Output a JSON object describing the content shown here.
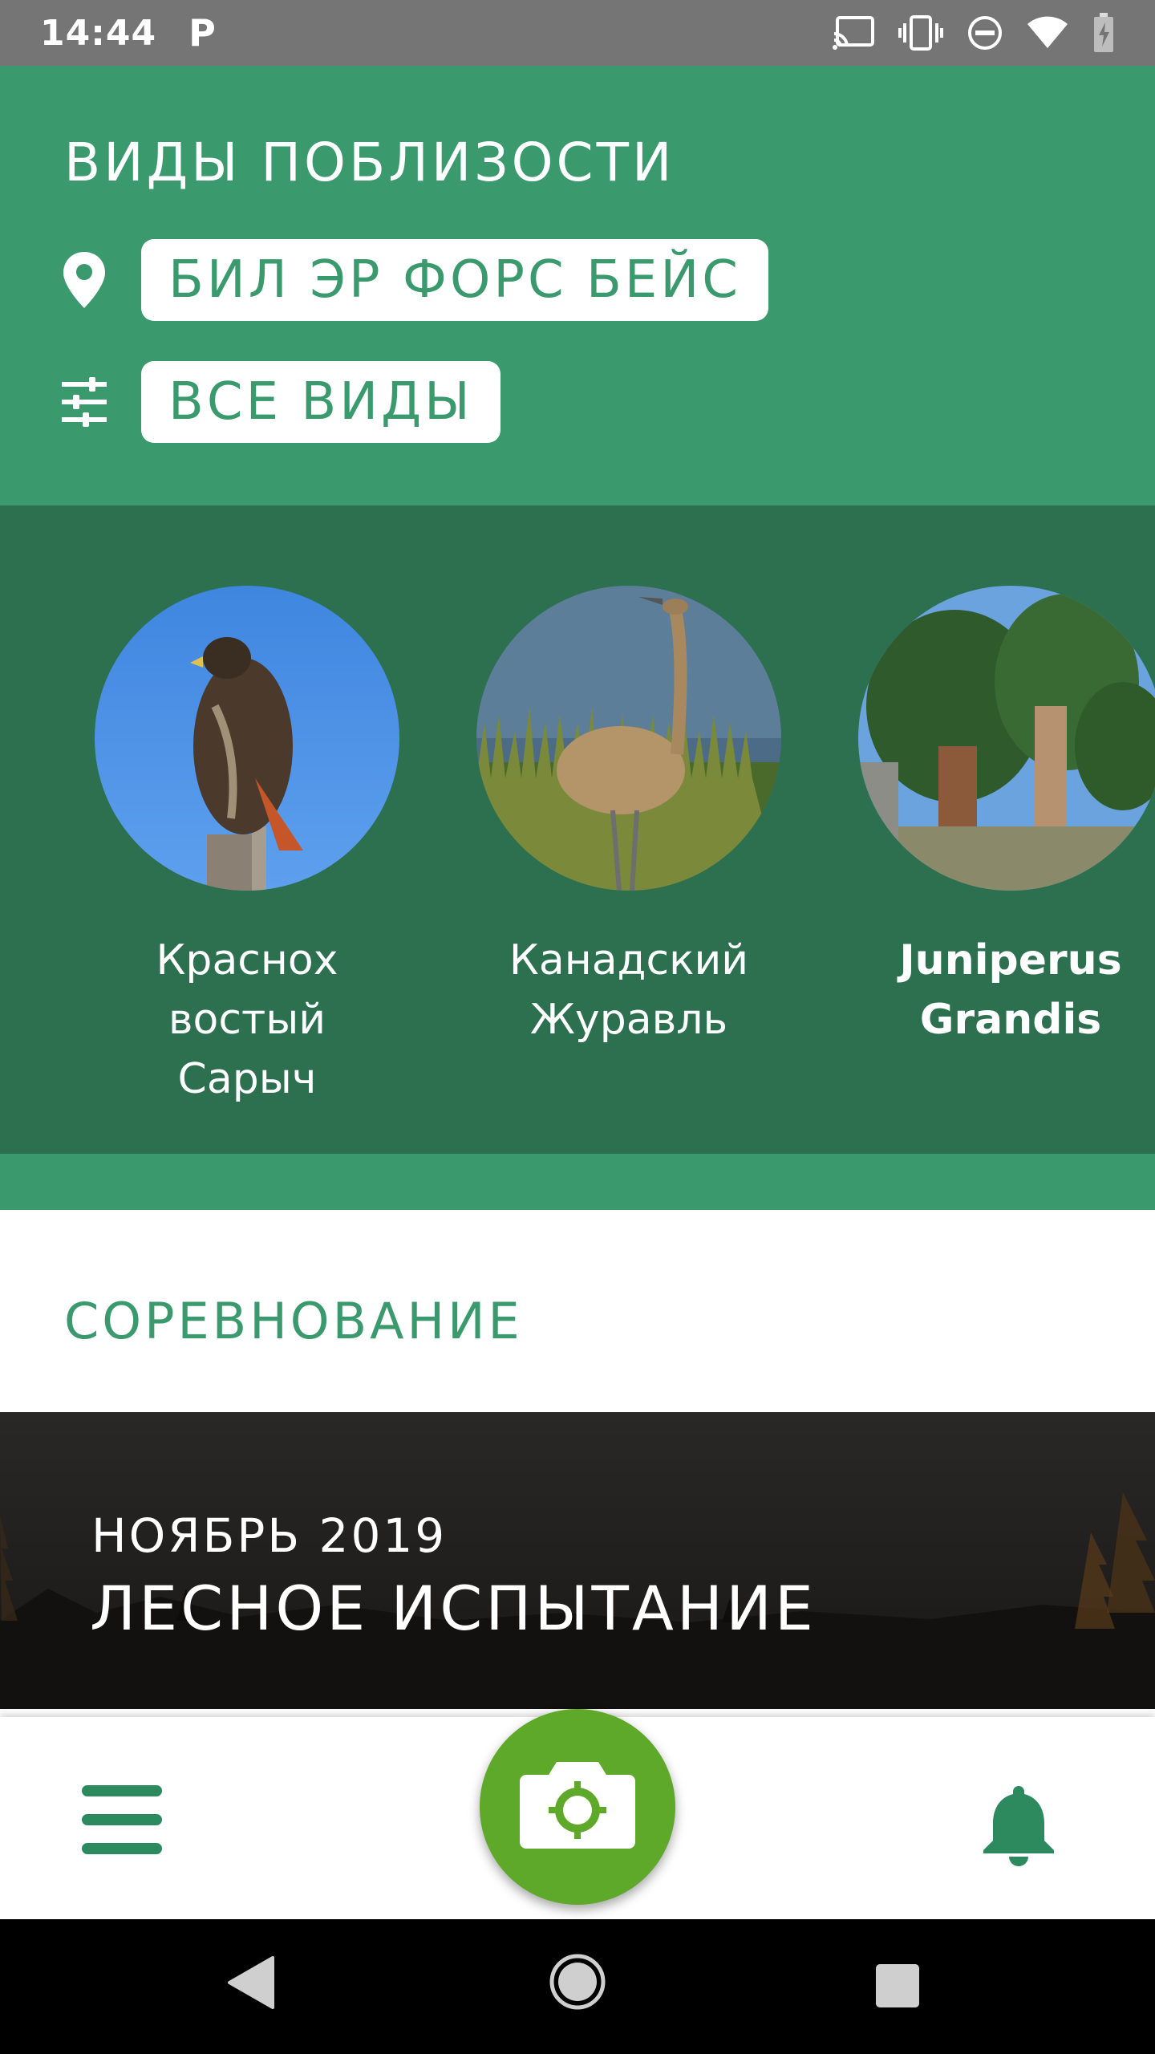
{
  "status_bar": {
    "time": "14:44",
    "app_indicator": "P",
    "icons": [
      "cast-icon",
      "vibrate-icon",
      "do-not-disturb-icon",
      "wifi-icon",
      "battery-charging-icon"
    ]
  },
  "header": {
    "title": "ВИДЫ ПОБЛИЗОСТИ",
    "location_label": "БИЛ ЭР ФОРС БЕЙС",
    "filter_label": "ВСЕ ВИДЫ"
  },
  "species": [
    {
      "name": "Краснох востый Сарыч",
      "image": "hawk-photo"
    },
    {
      "name": "Канадский Журавль",
      "image": "crane-photo"
    },
    {
      "name": "Juniperus Grandis",
      "image": "juniper-photo"
    }
  ],
  "challenge": {
    "section_title": "СОРЕВНОВАНИЕ",
    "month": "НОЯБРЬ 2019",
    "title": "ЛЕСНОЕ ИСПЫТАНИЕ"
  },
  "bottom_bar": {
    "menu_icon": "hamburger-menu-icon",
    "camera_icon": "camera-icon",
    "notifications_icon": "bell-icon"
  },
  "colors": {
    "primary_green": "#3a9a6e",
    "dark_green": "#2c7050",
    "camera_green": "#5ea82a",
    "status_bar": "#757575"
  }
}
